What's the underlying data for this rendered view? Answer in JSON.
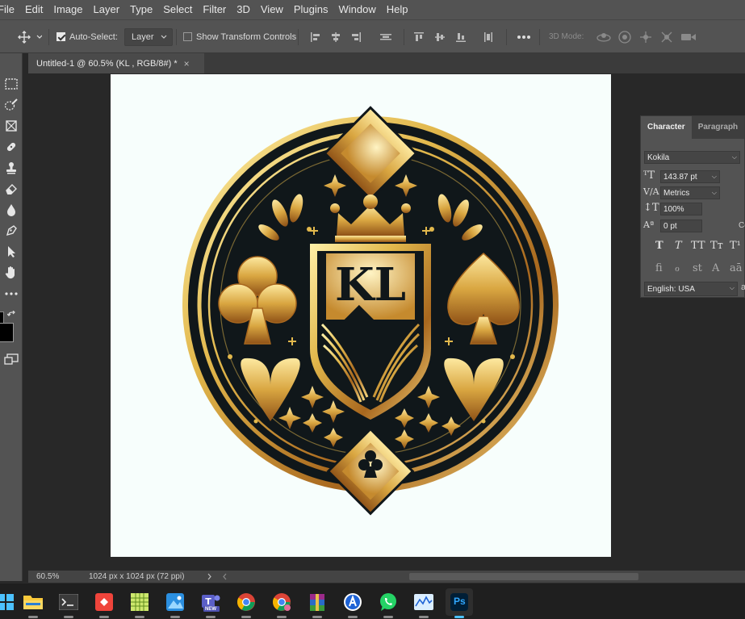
{
  "menu": [
    "File",
    "Edit",
    "Image",
    "Layer",
    "Type",
    "Select",
    "Filter",
    "3D",
    "View",
    "Plugins",
    "Window",
    "Help"
  ],
  "options_bar": {
    "auto_select_label": "Auto-Select:",
    "auto_select_checked": true,
    "layer_dropdown": "Layer",
    "show_transform_label": "Show Transform Controls",
    "show_transform_checked": false,
    "mode_3d_label": "3D Mode:"
  },
  "document": {
    "tab_title": "Untitled-1 @ 60.5% (KL , RGB/8#) *",
    "close_glyph": "×",
    "canvas_color": "#f7fefc",
    "logo_text": "KL"
  },
  "status": {
    "zoom": "60.5%",
    "doc_info": "1024 px x 1024 px (72 ppi)"
  },
  "character_panel": {
    "tabs": [
      "Character",
      "Paragraph"
    ],
    "active_tab": "Character",
    "font_family": "Kokila",
    "font_size": "143.87 pt",
    "kerning": "Metrics",
    "vertical_scale": "100%",
    "baseline_shift": "0 pt",
    "language": "English: USA",
    "style_buttons": [
      "T",
      "T",
      "TT",
      "Tт",
      "T¹"
    ],
    "opentype_buttons": [
      "fi",
      "ℴ",
      "st",
      "A",
      "aā"
    ],
    "partial_labels": {
      "right_a": "a",
      "right_c": "Co"
    }
  },
  "taskbar": {
    "apps": [
      {
        "name": "start",
        "icon": "windows-icon"
      },
      {
        "name": "file-explorer",
        "icon": "folder-icon",
        "running": true
      },
      {
        "name": "terminal",
        "icon": "terminal-icon",
        "running": true
      },
      {
        "name": "anydesk",
        "icon": "anydesk-icon",
        "running": true
      },
      {
        "name": "spreadsheet",
        "icon": "grid-icon",
        "running": true
      },
      {
        "name": "photos",
        "icon": "photos-icon",
        "running": true
      },
      {
        "name": "teams",
        "icon": "teams-icon",
        "badge": "NEW",
        "running": true
      },
      {
        "name": "chrome",
        "icon": "chrome-icon",
        "running": true
      },
      {
        "name": "chrome-profile",
        "icon": "chrome-icon",
        "running": true
      },
      {
        "name": "winrar",
        "icon": "winrar-icon",
        "running": true
      },
      {
        "name": "app-store",
        "icon": "store-icon",
        "running": true
      },
      {
        "name": "whatsapp",
        "icon": "whatsapp-icon",
        "running": true
      },
      {
        "name": "task-manager",
        "icon": "chart-icon",
        "running": true
      },
      {
        "name": "photoshop",
        "icon": "photoshop-icon",
        "label": "Ps",
        "running": true,
        "active": true
      }
    ]
  },
  "colors": {
    "ui_panel": "#535353",
    "ui_dark": "#282828",
    "gold": "#e2b84c",
    "logo_dark": "#10171a",
    "photoshop_blue": "#31a8ff",
    "taskbar_bg": "#1f1f1f"
  }
}
